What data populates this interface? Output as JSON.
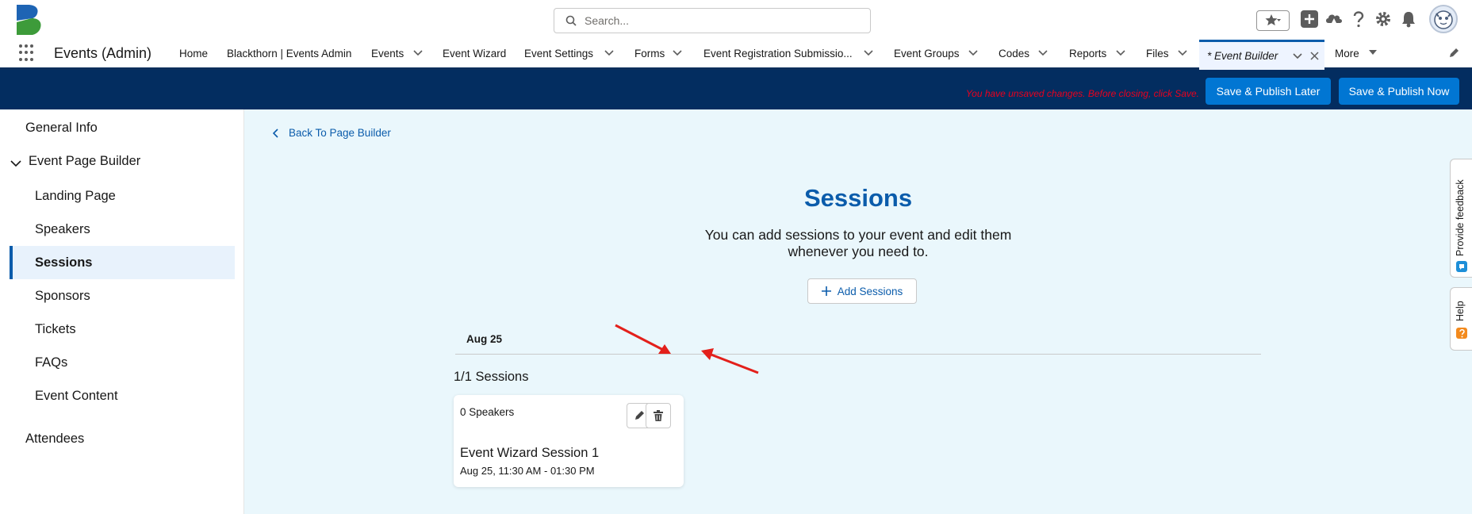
{
  "header": {
    "search_placeholder": "Search..."
  },
  "nav": {
    "app_name": "Events (Admin)",
    "items": [
      {
        "label": "Home"
      },
      {
        "label": "Blackthorn | Events Admin"
      },
      {
        "label": "Events"
      },
      {
        "label": "Event Wizard"
      },
      {
        "label": "Event Settings"
      },
      {
        "label": "Forms"
      },
      {
        "label": "Event Registration Submissio..."
      },
      {
        "label": "Event Groups"
      },
      {
        "label": "Codes"
      },
      {
        "label": "Reports"
      },
      {
        "label": "Files"
      }
    ],
    "active_tab": "* Event Builder",
    "more_label": "More"
  },
  "toolbar": {
    "warning": "You have unsaved changes. Before closing, click Save.",
    "publish_later_label": "Save & Publish Later",
    "publish_now_label": "Save & Publish Now"
  },
  "sidebar": {
    "general_info": "General Info",
    "event_page_builder": "Event Page Builder",
    "items": [
      {
        "label": "Landing Page"
      },
      {
        "label": "Speakers"
      },
      {
        "label": "Sessions"
      },
      {
        "label": "Sponsors"
      },
      {
        "label": "Tickets"
      },
      {
        "label": "FAQs"
      },
      {
        "label": "Event Content"
      }
    ],
    "attendees": "Attendees"
  },
  "main": {
    "back_label": "Back To Page Builder",
    "title": "Sessions",
    "subtitle_line1": "You can add sessions to your event and edit them",
    "subtitle_line2": "whenever you need to.",
    "add_button_label": "Add Sessions",
    "date_header": "Aug 25",
    "session_count": "1/1 Sessions",
    "session_card": {
      "speakers": "0 Speakers",
      "name": "Event Wizard Session 1",
      "time": "Aug 25, 11:30 AM - 01:30 PM"
    }
  },
  "side_tabs": {
    "feedback": "Provide feedback",
    "help": "Help"
  },
  "colors": {
    "brand": "#0176d3",
    "dark_bar": "#032d60",
    "main_bg": "#eaf7fc",
    "title_blue": "#0b5cab",
    "warning_red": "#ea001e",
    "annotation_arrow": "#e3201b"
  }
}
